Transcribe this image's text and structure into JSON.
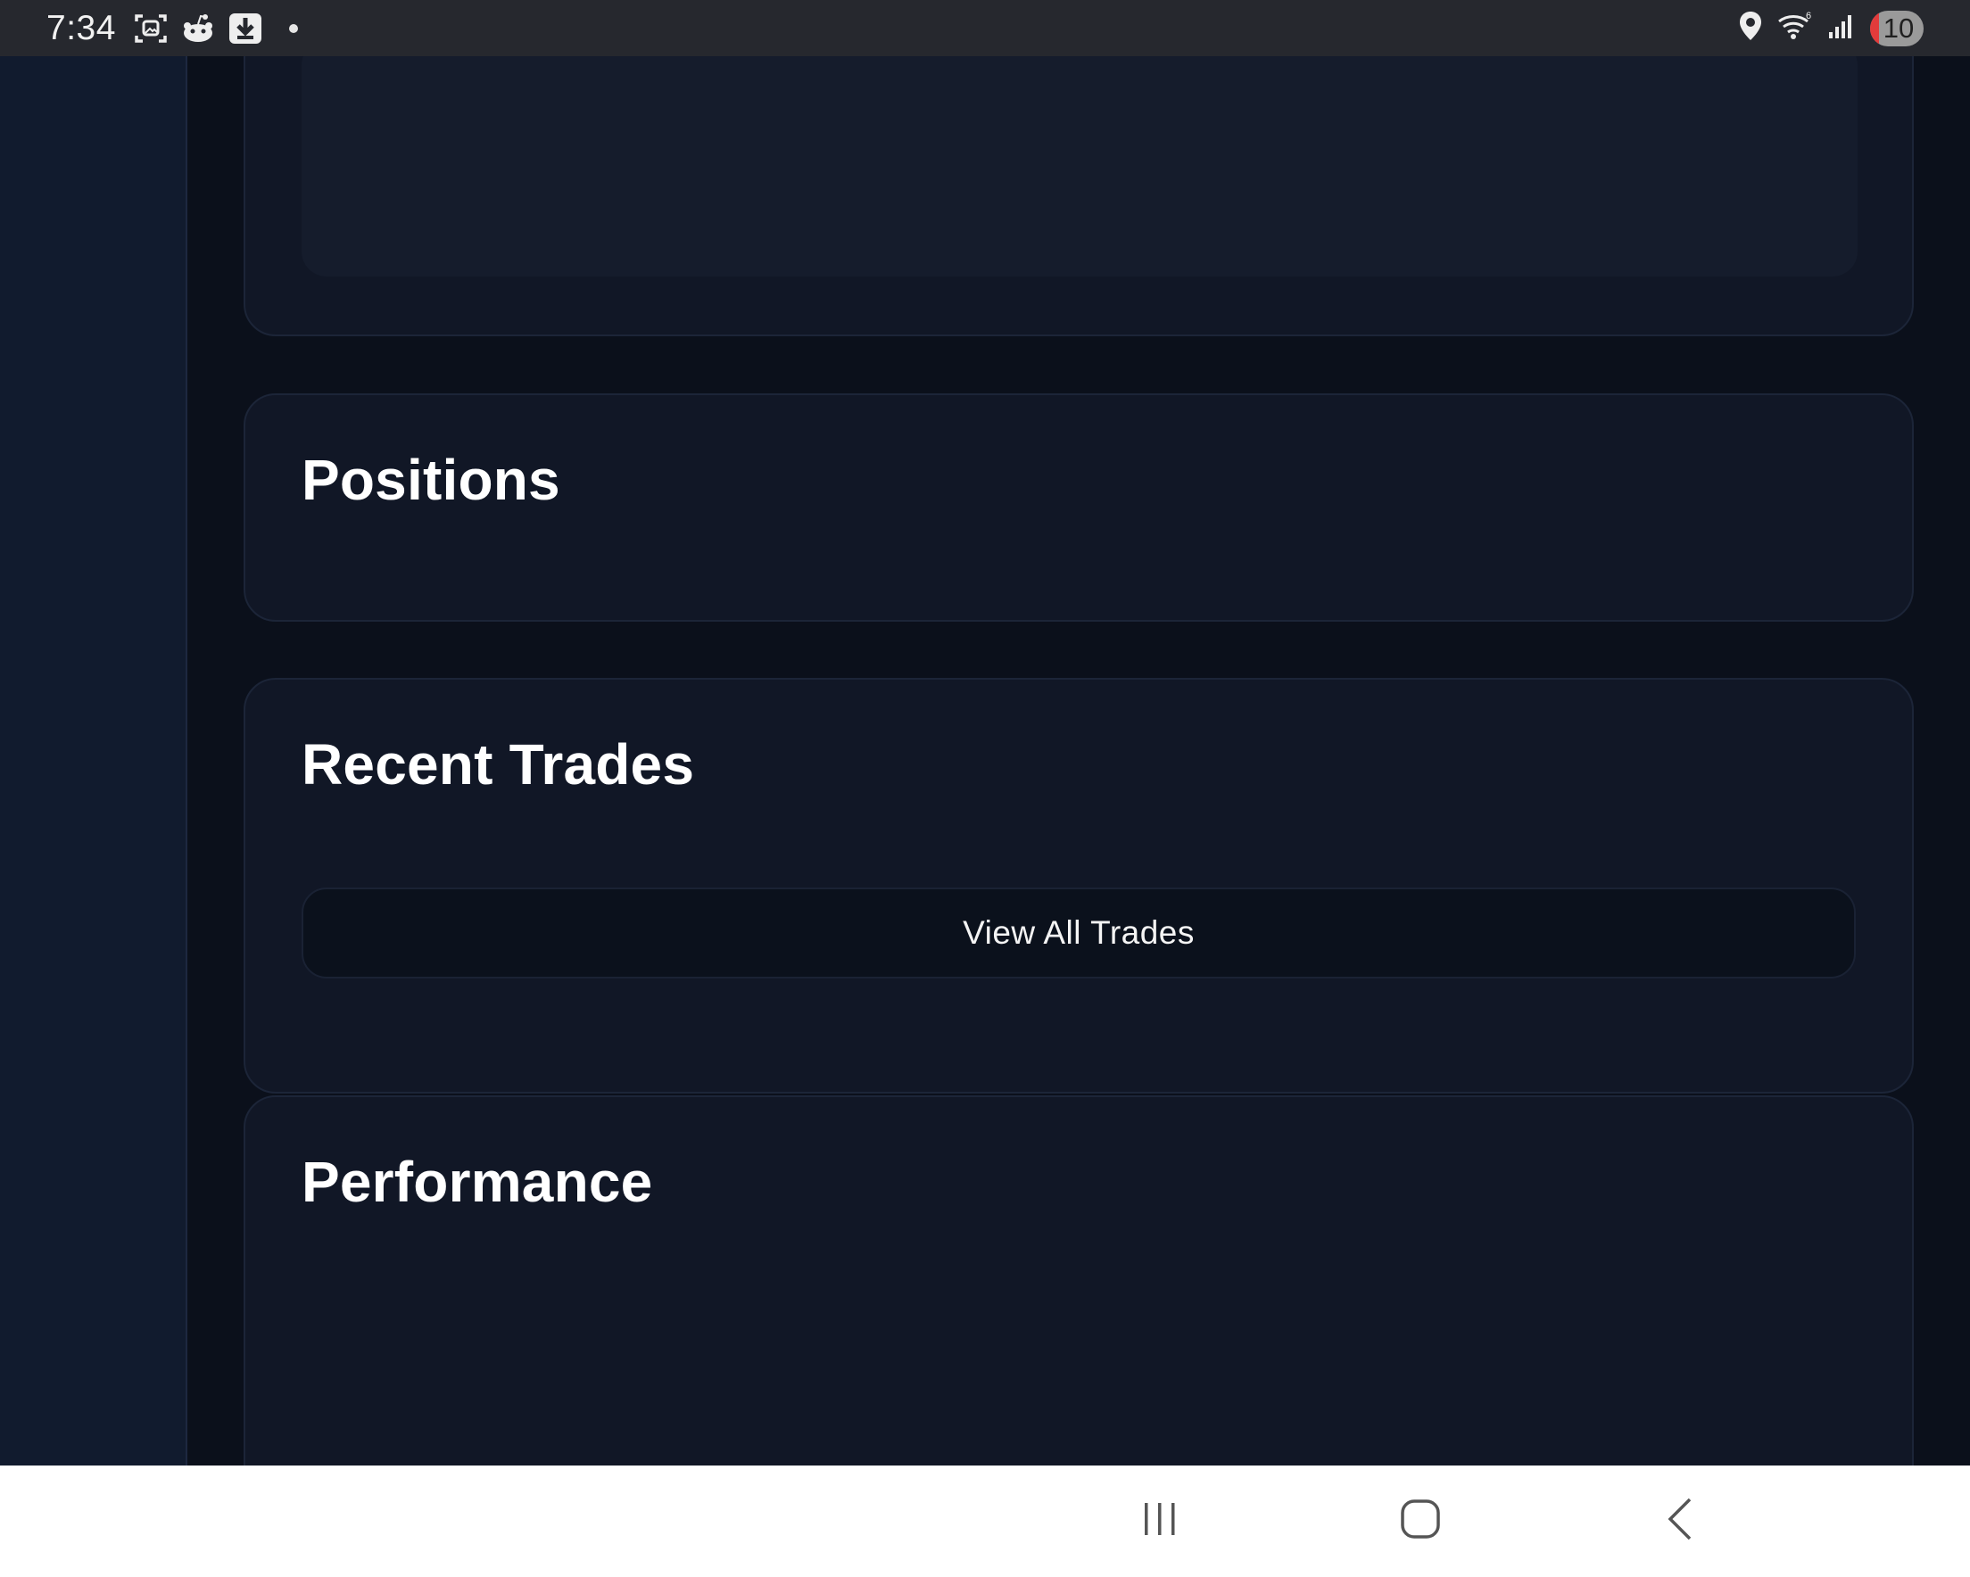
{
  "status_bar": {
    "time": "7:34",
    "battery_level": "10",
    "left_icons": [
      "screenshot-icon",
      "reddit-icon",
      "download-icon",
      "notification-dot"
    ],
    "right_icons": [
      "location-icon",
      "wifi-6-icon",
      "signal-icon",
      "battery-icon"
    ]
  },
  "sections": {
    "positions": {
      "title": "Positions"
    },
    "recent_trades": {
      "title": "Recent Trades",
      "view_all_label": "View All Trades"
    },
    "performance": {
      "title": "Performance"
    }
  },
  "nav_bar": {
    "buttons": [
      "recents-icon",
      "home-icon",
      "back-icon"
    ]
  },
  "colors": {
    "background": "#0b101b",
    "sidebar": "#111b2e",
    "card": "#111726",
    "card_border": "#1c2538",
    "status_bar": "#26282e",
    "battery_low": "#e23b3b"
  }
}
